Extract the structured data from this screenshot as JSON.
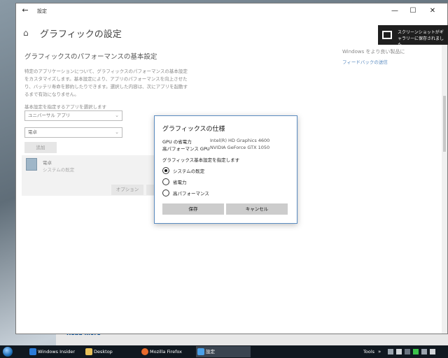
{
  "window": {
    "title": "設定",
    "back_icon": "back-arrow-icon",
    "minimize": "—",
    "maximize": "☐",
    "close": "✕"
  },
  "settings": {
    "page_title": "グラフィックの設定",
    "subtitle": "グラフィックスのパフォーマンスの基本設定",
    "description": "特定のアプリケーションについて、グラフィックスのパフォーマンスの基本設定をカスタマイズします。基本設定により、アプリのパフォーマンスを向上させたり、バッテリ寿命を節約したりできます。選択した内容は、次にアプリを起動するまで有効になりません。",
    "select_label": "基本設定を指定するアプリを選択します",
    "app_type_select": "ユニバーサル アプリ",
    "app_select": "電卓",
    "add_button": "追加",
    "app_card": {
      "name": "電卓",
      "subtitle": "システムの既定"
    },
    "options_button": "オプション",
    "right_text": "Windows をより良い製品に",
    "right_link": "フィードバックの送信"
  },
  "toast": {
    "text": "スクリーンショットがギャラリーに保存されました"
  },
  "dialog": {
    "title": "グラフィックスの仕様",
    "specs": [
      {
        "label": "GPU の省電力",
        "value": "Intel(R) HD Graphics 4600"
      },
      {
        "label": "高パフォーマンス GPU",
        "value": "NVIDIA GeForce GTX 1050"
      }
    ],
    "pref_label": "グラフィックス基本設定を指定します",
    "options": [
      {
        "label": "システムの既定",
        "selected": true
      },
      {
        "label": "省電力",
        "selected": false
      },
      {
        "label": "高パフォーマンス",
        "selected": false
      }
    ],
    "save_button": "保存",
    "cancel_button": "キャンセル"
  },
  "background": {
    "link_text": "Read more"
  },
  "taskbar": {
    "items": [
      {
        "label": "Windows Insider Prog...",
        "color": "#2b7bd8"
      },
      {
        "label": "Desktop",
        "color": "#e8c15a"
      },
      {
        "label": "Mozilla Firefox",
        "color": "#e86a2b"
      },
      {
        "label": "設定",
        "color": "#4aa0e8"
      }
    ],
    "tools_label": "Tools"
  },
  "colors": {
    "accent": "#5a8bc0",
    "button_gray": "#cccccc",
    "taskbar": "#101820"
  }
}
